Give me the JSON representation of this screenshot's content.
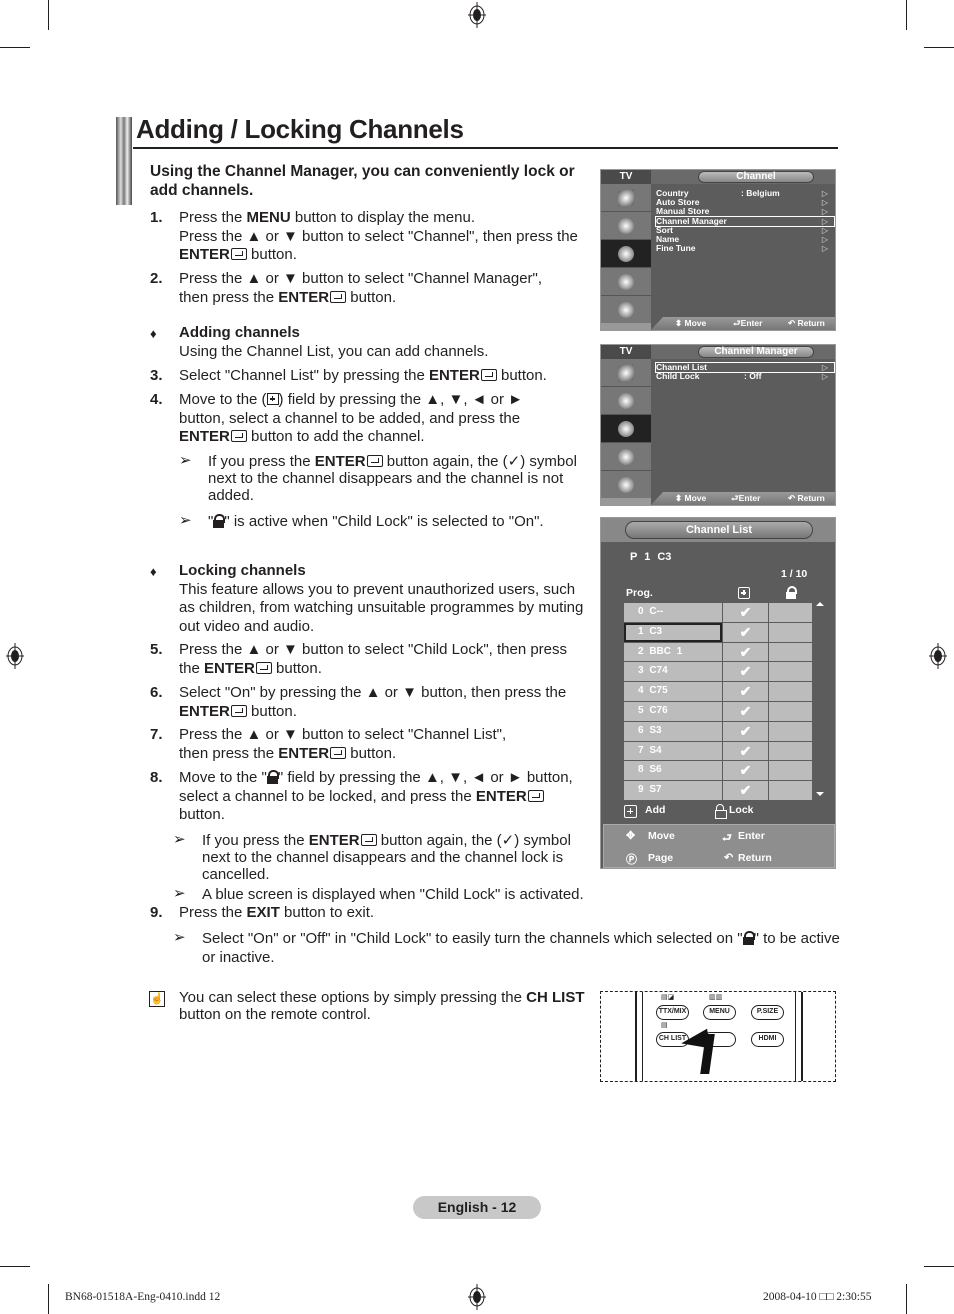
{
  "page": {
    "title": "Adding / Locking Channels",
    "intro": "Using the Channel Manager, you can conveniently lock or add channels.",
    "page_label": "English - 12",
    "footer_left": "BN68-01518A-Eng-0410.indd   12",
    "footer_right": "2008-04-10   □□ 2:30:55"
  },
  "steps": {
    "s1": {
      "num": "1.",
      "l1a": "Press the ",
      "l1b": "MENU",
      "l1c": " button to display the menu.",
      "l2": "Press the ▲ or ▼ button to select \"Channel\", then press the",
      "l3a": "ENTER",
      "l3b": " button."
    },
    "s2": {
      "num": "2.",
      "l1": "Press the ▲ or ▼ button to select \"Channel Manager\",",
      "l2a": "then press the ",
      "l2b": "ENTER",
      "l2c": " button."
    },
    "adding": {
      "bullet": "♦",
      "heading": "Adding channels",
      "desc": "Using the Channel List, you can add channels."
    },
    "s3": {
      "num": "3.",
      "a": "Select \"Channel List\" by pressing the ",
      "b": "ENTER",
      "c": " button."
    },
    "s4": {
      "num": "4.",
      "l1a": "Move to the (",
      "l1b": ") field by pressing the ▲, ▼, ◄ or ►",
      "l2": "button, select a channel to be added, and press the",
      "l3a": "ENTER",
      "l3b": " button to add the channel."
    },
    "note1": {
      "arrow": "➢",
      "l1a": "If you press the ",
      "l1b": "ENTER",
      "l1c": " button again, the (✓) symbol",
      "l2": "next to the channel disappears and the channel is not",
      "l3": "added."
    },
    "note2": {
      "arrow": "➢",
      "a": "\"",
      "b": "\" is active when \"Child Lock\" is selected to \"On\"."
    },
    "locking": {
      "bullet": "♦",
      "heading": "Locking channels",
      "l1": "This feature allows you to prevent unauthorized users, such",
      "l2": "as children, from watching unsuitable programmes by muting",
      "l3": "out video and audio."
    },
    "s5": {
      "num": "5.",
      "l1": "Press the ▲ or ▼ button to select \"Child Lock\", then press",
      "l2a": "the ",
      "l2b": "ENTER",
      "l2c": " button."
    },
    "s6": {
      "num": "6.",
      "l1": "Select \"On\" by pressing the ▲ or ▼ button, then press the",
      "l2a": "ENTER",
      "l2b": " button."
    },
    "s7": {
      "num": "7.",
      "l1": "Press the ▲ or ▼ button to select \"Channel List\",",
      "l2a": "then press the ",
      "l2b": "ENTER",
      "l2c": " button."
    },
    "s8": {
      "num": "8.",
      "l1a": "Move to the \"",
      "l1b": "\" field by pressing the ▲, ▼, ◄ or ► button,",
      "l2a": "select a channel to be locked, and press the ",
      "l2b": "ENTER",
      "l3": "button."
    },
    "note3": {
      "arrow": "➢",
      "l1a": "If you press the ",
      "l1b": "ENTER",
      "l1c": " button again, the (✓) symbol",
      "l2": "next to the channel disappears and the channel lock is",
      "l3": "cancelled."
    },
    "note4": {
      "arrow": "➢",
      "text": "A blue screen is displayed when \"Child Lock\" is activated."
    },
    "s9": {
      "num": "9.",
      "a": "Press the ",
      "b": "EXIT",
      "c": " button to exit."
    },
    "note5": {
      "arrow": "➢",
      "l1a": "Select \"On\" or \"Off\" in \"Child Lock\" to easily turn the channels which selected on \"",
      "l1b": "\" to be active",
      "l2": "or inactive."
    },
    "memo": {
      "l1a": "You can select these options by simply pressing the ",
      "l1b": "CH LIST",
      "l2": "button on the remote control."
    }
  },
  "tv_channel_menu": {
    "side_title": "TV",
    "menu_title": "Channel",
    "items": [
      {
        "label": "Country",
        "value": ": Belgium"
      },
      {
        "label": "Auto Store",
        "value": ""
      },
      {
        "label": "Manual Store",
        "value": ""
      },
      {
        "label": "Channel Manager",
        "value": "",
        "highlighted": true
      },
      {
        "label": "Sort",
        "value": ""
      },
      {
        "label": "Name",
        "value": ""
      },
      {
        "label": "Fine Tune",
        "value": ""
      }
    ],
    "footer": {
      "move": "⬍ Move",
      "enter": "Enter",
      "return": "↶ Return"
    }
  },
  "tv_channel_manager": {
    "side_title": "TV",
    "menu_title": "Channel Manager",
    "items": [
      {
        "label": "Channel List",
        "value": "",
        "highlighted": true
      },
      {
        "label": "Child Lock",
        "value": ": Off"
      }
    ],
    "footer": {
      "move": "⬍ Move",
      "enter": "Enter",
      "return": "↶ Return"
    }
  },
  "channel_list": {
    "title": "Channel List",
    "current": "P  1  C3",
    "page": "1 / 10",
    "prog_header": "Prog.",
    "rows": [
      {
        "prog": "0   C--",
        "added": "✔",
        "locked": ""
      },
      {
        "prog": "1   C3",
        "added": "✔",
        "locked": "",
        "selected": true
      },
      {
        "prog": "2   BBC 1",
        "added": "✔",
        "locked": ""
      },
      {
        "prog": "3  C74",
        "added": "✔",
        "locked": ""
      },
      {
        "prog": "4  C75",
        "added": "✔",
        "locked": ""
      },
      {
        "prog": "5  C76",
        "added": "✔",
        "locked": ""
      },
      {
        "prog": "6  S3",
        "added": "✔",
        "locked": ""
      },
      {
        "prog": "7  S4",
        "added": "✔",
        "locked": ""
      },
      {
        "prog": "8  S6",
        "added": "✔",
        "locked": ""
      },
      {
        "prog": "9  S7",
        "added": "✔",
        "locked": ""
      }
    ],
    "legend": {
      "add": "Add",
      "lock": "Lock"
    },
    "footer": {
      "move": "Move",
      "enter": "Enter",
      "page": "Page",
      "return": "Return"
    }
  },
  "remote": {
    "buttons": [
      "TTX/MIX",
      "MENU",
      "P.SIZE",
      "CH LIST",
      "HDMI"
    ]
  }
}
